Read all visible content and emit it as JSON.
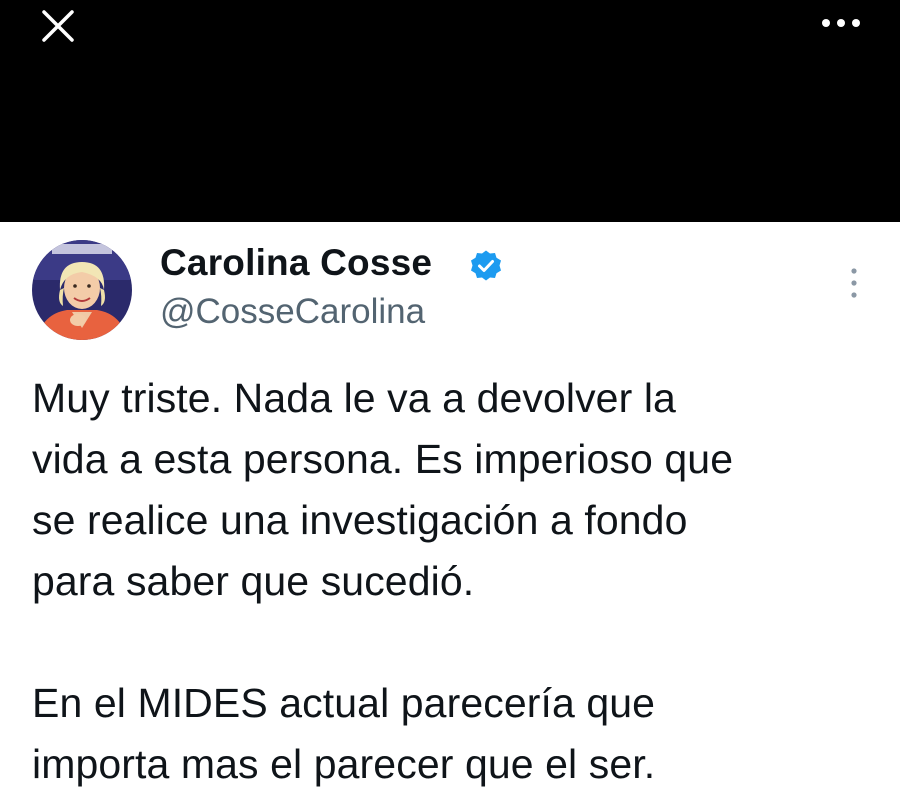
{
  "header": {
    "close_icon": "close-icon",
    "more_icon": "more-horizontal-icon",
    "background": "#000000"
  },
  "tweet": {
    "author": {
      "name": "Carolina Cosse",
      "handle": "@CosseCarolina",
      "verified_icon": "verified-badge-icon",
      "verified_color": "#1d9bf0"
    },
    "more_options_icon": "more-vertical-icon",
    "paragraphs": [
      "Muy triste. Nada le va a devolver la\nvida a esta persona. Es imperioso que\nse realice una investigación a fondo\npara saber que sucedió.\n\nEn el MIDES actual parecería que\nimporta mas el parecer que el ser."
    ]
  },
  "colors": {
    "text_primary": "#0f1419",
    "text_secondary": "#536471",
    "accent": "#1d9bf0"
  }
}
